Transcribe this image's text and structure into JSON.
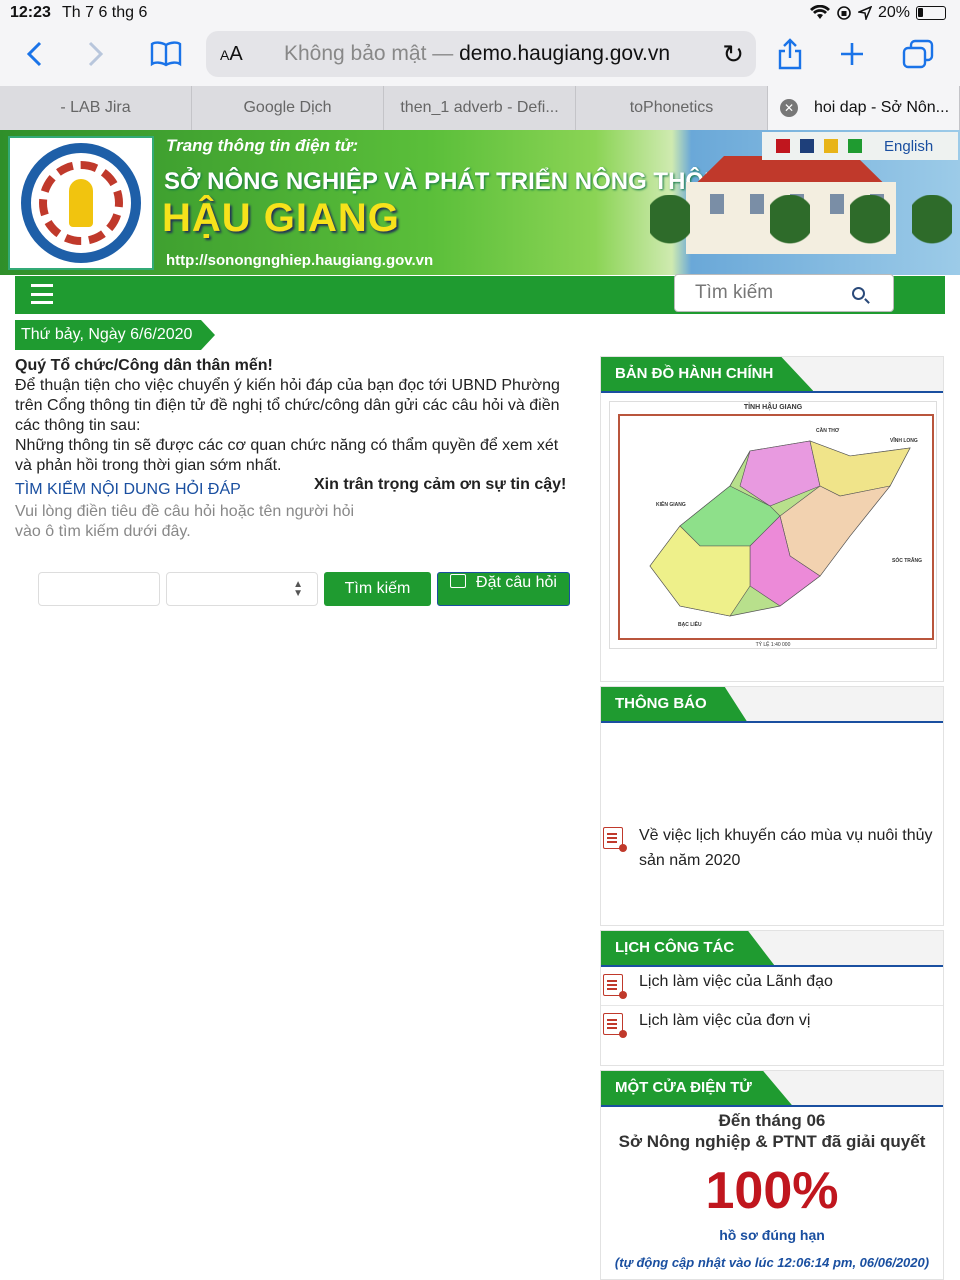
{
  "status_bar": {
    "time": "12:23",
    "date": "Th 7 6 thg 6",
    "battery": "20%"
  },
  "browser": {
    "aa_label": "AA",
    "not_secure": "Không bảo mật —",
    "domain": "demo.haugiang.gov.vn",
    "tabs": [
      {
        "label": "- LAB Jira"
      },
      {
        "label": "Google Dịch"
      },
      {
        "label": "then_1 adverb - Defi..."
      },
      {
        "label": "toPhonetics"
      },
      {
        "label": "hoi dap - Sở Nôn..."
      }
    ]
  },
  "banner": {
    "kicker": "Trang thông tin điện tử:",
    "org": "SỞ NÔNG NGHIỆP VÀ PHÁT TRIỂN NÔNG THÔN",
    "province": "HẬU GIANG",
    "url": "http://sonongnghiep.haugiang.gov.vn",
    "logo_text": "BỘ NÔNG NGHIỆP VÀ PHÁT TRIỂN NÔNG THÔN HẬU GIANG",
    "theme_colors": [
      "#c0161e",
      "#1e3f7a",
      "#e8b418",
      "#1f9b30"
    ],
    "language": "English"
  },
  "nav": {
    "search_placeholder": "Tìm kiếm"
  },
  "date_ribbon": "Thứ bảy, Ngày 6/6/2020",
  "intro": {
    "greeting": "Quý Tổ chức/Công dân thân mến!",
    "p1": "Để thuận tiện cho việc chuyển ý kiến hỏi đáp của bạn đọc tới UBND Phường trên Cổng thông tin điện tử đề nghị tổ chức/công dân gửi các câu hỏi và điền các thông tin sau:",
    "p2": "Những thông tin sẽ được các cơ quan chức năng có thẩm quyền để xem xét và phản hồi trong thời gian sớm nhất.",
    "thanks": "Xin trân trọng cảm ơn sự tin cậy!"
  },
  "search_section": {
    "heading": "TÌM KIẾM NỘI DUNG HỎI ĐÁP",
    "hint": "Vui lòng điền tiêu đề câu hỏi hoặc tên người hỏi vào ô tìm kiếm dưới đây.",
    "input_value": "",
    "select_value": "",
    "search_button": "Tìm kiếm",
    "ask_button": "Đặt câu hỏi"
  },
  "sidebar": {
    "map_panel": {
      "title": "BẢN ĐỒ HÀNH CHÍNH",
      "map_title": "TỈNH HẬU GIANG",
      "places": [
        "CẦN THƠ",
        "VĨNH LONG",
        "KIÊN GIANG",
        "SÓC TRĂNG",
        "BẠC LIÊU"
      ],
      "scale": "TỶ LỆ 1:40 000"
    },
    "notice_panel": {
      "title": "THÔNG BÁO",
      "item": "Về việc lịch khuyến cáo mùa vụ nuôi thủy sản năm 2020"
    },
    "schedule_panel": {
      "title": "LỊCH CÔNG TÁC",
      "items": [
        "Lịch làm việc của Lãnh đạo",
        "Lịch làm việc của đơn vị"
      ]
    },
    "onestop_panel": {
      "title": "MỘT CỬA ĐIỆN TỬ",
      "line1": "Đến tháng 06",
      "line2": "Sở Nông nghiệp & PTNT đã giải quyết",
      "percent": "100%",
      "line3": "hồ sơ đúng hạn",
      "updated": "(tự động cập nhật vào lúc 12:06:14 pm, 06/06/2020)"
    }
  }
}
